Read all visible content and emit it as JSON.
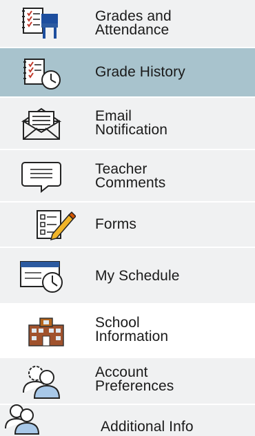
{
  "nav": {
    "items": [
      {
        "label": "Grades and\nAttendance",
        "icon": "grades-attendance-icon"
      },
      {
        "label": "Grade History",
        "icon": "grade-history-icon",
        "active": true
      },
      {
        "label": "Email\nNotification",
        "icon": "email-notification-icon"
      },
      {
        "label": "Teacher\nComments",
        "icon": "teacher-comments-icon"
      },
      {
        "label": "Forms",
        "icon": "forms-icon"
      },
      {
        "label": "My Schedule",
        "icon": "my-schedule-icon"
      },
      {
        "label": "School\nInformation",
        "icon": "school-information-icon"
      },
      {
        "label": "Account\nPreferences",
        "icon": "account-preferences-icon"
      },
      {
        "label": "Additional Info",
        "icon": "additional-info-icon"
      }
    ]
  },
  "colors": {
    "active_bg": "#a8c3cd",
    "row_bg": "#f0f1f2",
    "icon_blue": "#2c5aa0",
    "icon_red": "#c0392b"
  }
}
